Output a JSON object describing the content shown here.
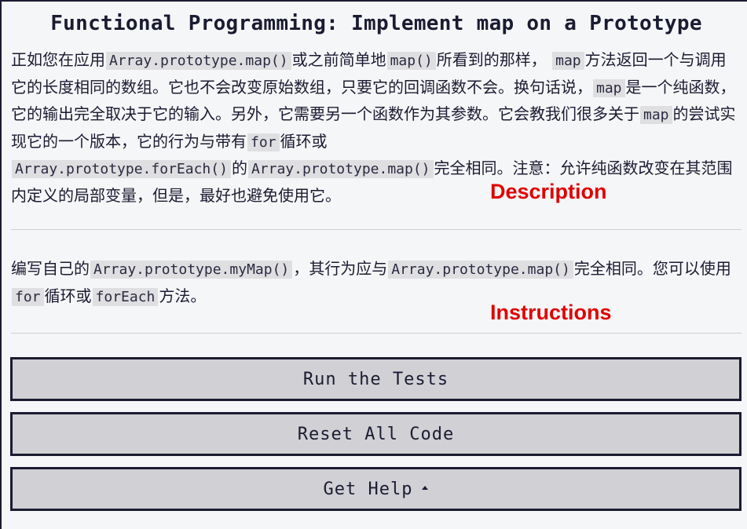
{
  "challenge": {
    "title": "Functional Programming: Implement map on a Prototype"
  },
  "description": {
    "t1": "正如您在应用",
    "c1": "Array.prototype.map()",
    "t2": "或之前简单地",
    "c2": "map()",
    "t3": "所看到的那样， ",
    "c3": "map",
    "t4": "方法返回一个与调用它的长度相同的数组。它也不会改变原始数组，只要它的回调函数不会。换句话说，",
    "c4": "map",
    "t5": "是一个纯函数，它的输出完全取决于它的输入。另外，它需要另一个函数作为其参数。它会教我们很多关于",
    "c5": "map",
    "t6": "的尝试实现它的一个版本，它的行为与带有",
    "c6": "for",
    "t7": "循环或",
    "c7": "Array.prototype.forEach()",
    "t8": "的",
    "c8": "Array.prototype.map()",
    "t9": "完全相同。注意：允许纯函数改变在其范围内定义的局部变量，但是，最好也避免使用它。"
  },
  "instructions": {
    "t1": "编写自己的",
    "c1": "Array.prototype.myMap()",
    "t2": "，其行为应与",
    "c2": "Array.prototype.map()",
    "t3": "完全相同。您可以使用",
    "c3": "for",
    "t4": "循环或",
    "c4": "forEach",
    "t5": "方法。"
  },
  "annotations": {
    "description_label": "Description",
    "instructions_label": "Instructions",
    "label_color": "#e00000"
  },
  "buttons": {
    "run_tests": "Run the Tests",
    "reset_code": "Reset All Code",
    "get_help": "Get Help"
  },
  "icons": {
    "get_help_caret": "caret-up-icon"
  }
}
